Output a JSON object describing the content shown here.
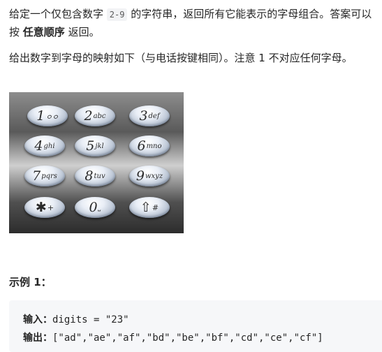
{
  "intro": {
    "part1": "给定一个仅包含数字 ",
    "code": "2-9",
    "part2": " 的字符串，返回所有它能表示的字母组合。答案可以按 ",
    "bold": "任意顺序",
    "part3": " 返回。"
  },
  "mapping_text": "给出数字到字母的映射如下（与电话按键相同）。注意 1 不对应任何字母。",
  "keypad": {
    "keys": [
      {
        "digit": "1",
        "letters": "ㅇㅇ"
      },
      {
        "digit": "2",
        "letters": "abc"
      },
      {
        "digit": "3",
        "letters": "def"
      },
      {
        "digit": "4",
        "letters": "ghi"
      },
      {
        "digit": "5",
        "letters": "jkl"
      },
      {
        "digit": "6",
        "letters": "mno"
      },
      {
        "digit": "7",
        "letters": "pqrs"
      },
      {
        "digit": "8",
        "letters": "tuv"
      },
      {
        "digit": "9",
        "letters": "wxyz"
      },
      {
        "digit": "✱",
        "letters": "+"
      },
      {
        "digit": "0",
        "letters": "⎵"
      },
      {
        "digit": "⇧",
        "letters": "#"
      }
    ]
  },
  "example": {
    "title": "示例 1：",
    "input_label": "输入：",
    "input_value": "digits = \"23\"",
    "output_label": "输出：",
    "output_value": "[\"ad\",\"ae\",\"af\",\"bd\",\"be\",\"bf\",\"cd\",\"ce\",\"cf\"]"
  }
}
